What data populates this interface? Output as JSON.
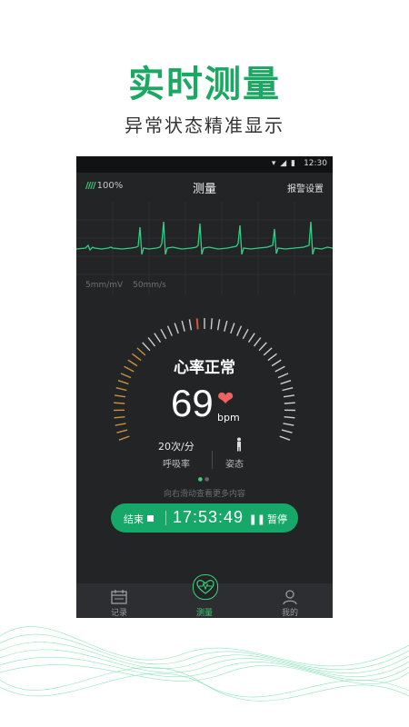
{
  "promo": {
    "headline": "实时测量",
    "subheadline": "异常状态精准显示"
  },
  "statusbar": {
    "time": "12:30",
    "icons": [
      "wifi-icon",
      "signal-icon",
      "battery-icon"
    ]
  },
  "header": {
    "battery": "100%",
    "title": "测量",
    "alarm_settings": "报警设置"
  },
  "ecg": {
    "scale_amplitude": "5mm/mV",
    "scale_speed": "50mm/s"
  },
  "gauge": {
    "status": "心率正常",
    "heart_rate": "69",
    "unit": "bpm"
  },
  "metrics": {
    "respiration_value": "20次/分",
    "respiration_label": "呼吸率",
    "posture_label": "姿态"
  },
  "pager": {
    "hint": "向右滑动查看更多内容"
  },
  "control": {
    "end_label": "结束",
    "timer": "17:53:49",
    "pause_label": "暂停"
  },
  "tabs": [
    {
      "label": "记录"
    },
    {
      "label": "测量"
    },
    {
      "label": "我的"
    }
  ],
  "colors": {
    "accent": "#1aa862",
    "heart": "#f06262",
    "phone_bg": "#232426"
  }
}
